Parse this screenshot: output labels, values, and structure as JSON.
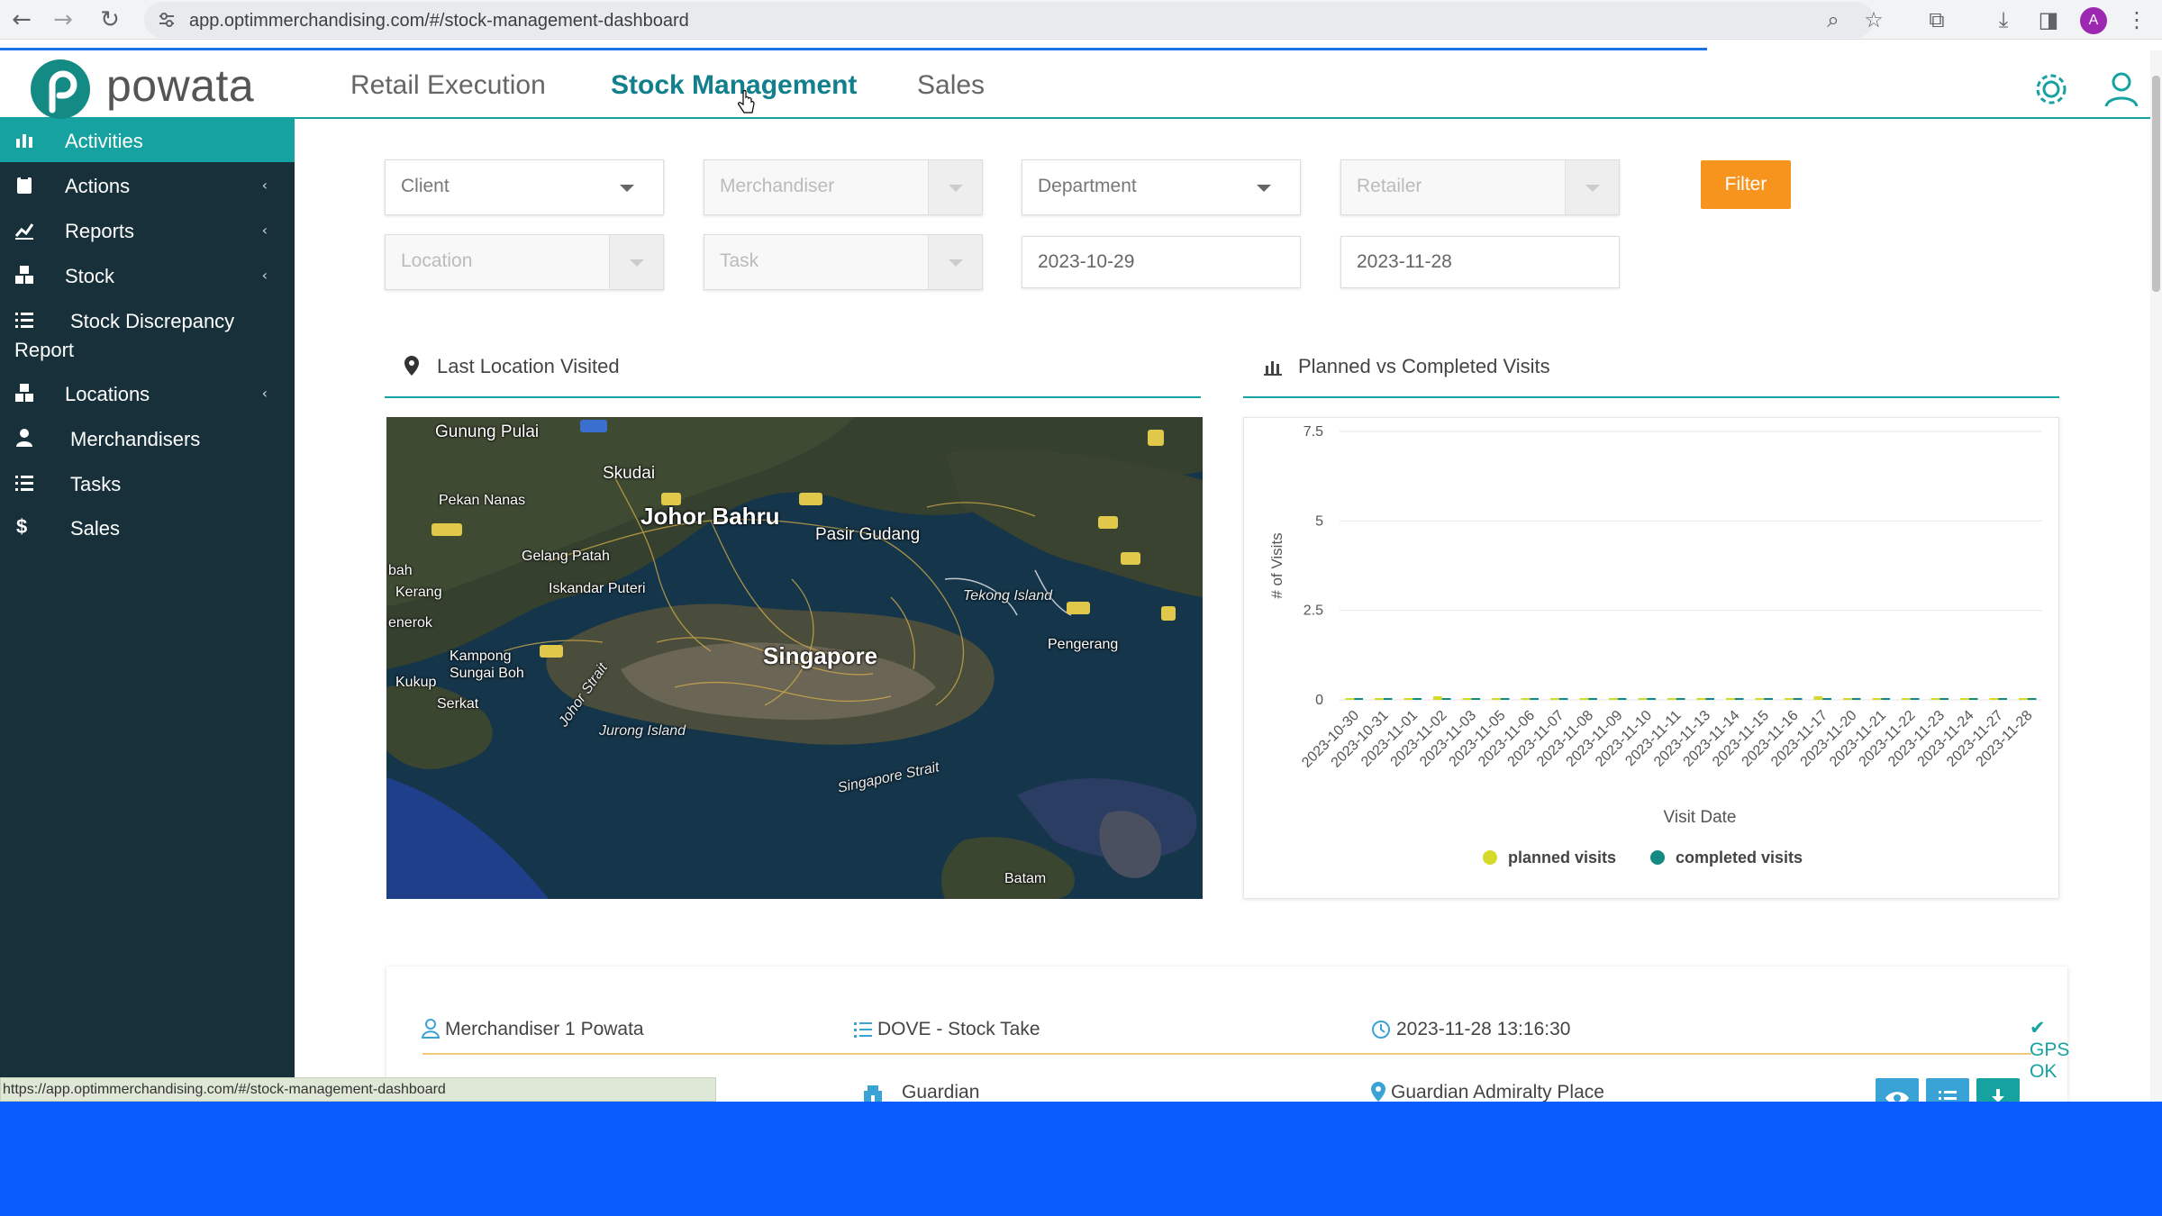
{
  "browser": {
    "url": "app.optimmerchandising.com/#/stock-management-dashboard",
    "status_url": "https://app.optimmerchandising.com/#/stock-management-dashboard",
    "profile_initial": "A"
  },
  "header": {
    "logo_text": "powata",
    "nav": [
      {
        "label": "Retail Execution",
        "active": false
      },
      {
        "label": "Stock Management",
        "active": true
      },
      {
        "label": "Sales",
        "active": false
      }
    ]
  },
  "sidebar": {
    "items": [
      {
        "label": "Activities",
        "icon": "bar-chart-icon",
        "active": true,
        "chevron": false
      },
      {
        "label": "Actions",
        "icon": "clipboard-icon",
        "chevron": true
      },
      {
        "label": "Reports",
        "icon": "line-chart-icon",
        "chevron": true
      },
      {
        "label": "Stock",
        "icon": "boxes-icon",
        "chevron": true
      },
      {
        "label": "Stock Discrepancy",
        "label2": "Report",
        "icon": "list-icon",
        "chevron": false
      },
      {
        "label": "Locations",
        "icon": "boxes-icon",
        "chevron": true
      },
      {
        "label": "Merchandisers",
        "icon": "user-icon",
        "chevron": false
      },
      {
        "label": "Tasks",
        "icon": "list-icon",
        "chevron": false
      },
      {
        "label": "Sales",
        "icon": "dollar-icon",
        "chevron": false
      }
    ]
  },
  "filters": {
    "client": "Client",
    "merchandiser": "Merchandiser",
    "department": "Department",
    "retailer": "Retailer",
    "location": "Location",
    "task": "Task",
    "date_from": "2023-10-29",
    "date_to": "2023-11-28",
    "filter_button": "Filter"
  },
  "map_panel": {
    "title": "Last Location Visited",
    "labels": [
      "Johor Bahru",
      "Singapore",
      "Skudai",
      "Pasir Gudang",
      "Gunung Pulai",
      "Pekan Nanas",
      "Gelang Patah",
      "Iskandar Puteri",
      "Kampong Sungai Boh",
      "Kukup",
      "Serkat",
      "Tekong Island",
      "Pengerang",
      "Jurong Island",
      "Johor Strait",
      "Singapore Strait",
      "Batam",
      "Kerang",
      "enerok",
      "bah"
    ]
  },
  "chart_panel": {
    "title": "Planned vs Completed Visits"
  },
  "chart_data": {
    "type": "bar",
    "xlabel": "Visit Date",
    "ylabel": "# of Visits",
    "ylim": [
      0,
      7.5
    ],
    "yticks": [
      "7.5",
      "5",
      "2.5",
      "0"
    ],
    "legend_position": "bottom",
    "categories": [
      "2023-10-30",
      "2023-10-31",
      "2023-11-01",
      "2023-11-02",
      "2023-11-03",
      "2023-11-05",
      "2023-11-06",
      "2023-11-07",
      "2023-11-08",
      "2023-11-09",
      "2023-11-10",
      "2023-11-11",
      "2023-11-13",
      "2023-11-14",
      "2023-11-15",
      "2023-11-16",
      "2023-11-17",
      "2023-11-20",
      "2023-11-21",
      "2023-11-22",
      "2023-11-23",
      "2023-11-24",
      "2023-11-27",
      "2023-11-28"
    ],
    "series": [
      {
        "name": "planned visits",
        "color": "#d4d92a",
        "values": [
          0.05,
          0.05,
          0.05,
          0.1,
          0.05,
          0.05,
          0.05,
          0.05,
          0.05,
          0.05,
          0.05,
          0.05,
          0.05,
          0.05,
          0.05,
          0.05,
          0.1,
          0.05,
          0.05,
          0.05,
          0.05,
          0.05,
          0.05,
          0.05
        ]
      },
      {
        "name": "completed visits",
        "color": "#138a84",
        "values": [
          0.05,
          0.05,
          0.05,
          0.05,
          0.05,
          0.05,
          0.05,
          0.05,
          0.05,
          0.05,
          0.05,
          0.05,
          0.05,
          0.05,
          0.05,
          0.05,
          0.05,
          0.05,
          0.05,
          0.05,
          0.05,
          0.05,
          0.05,
          0.05
        ]
      }
    ]
  },
  "visit": {
    "merchandiser": "Merchandiser 1 Powata",
    "task": "DOVE - Stock Take",
    "datetime": "2023-11-28 13:16:30",
    "gps": "GPS OK",
    "retailer": "Guardian",
    "location": "Guardian Admiralty Place"
  },
  "colors": {
    "accent": "#17a2a2",
    "sidebar_bg": "#17303a",
    "filter_button": "#f7941d"
  }
}
